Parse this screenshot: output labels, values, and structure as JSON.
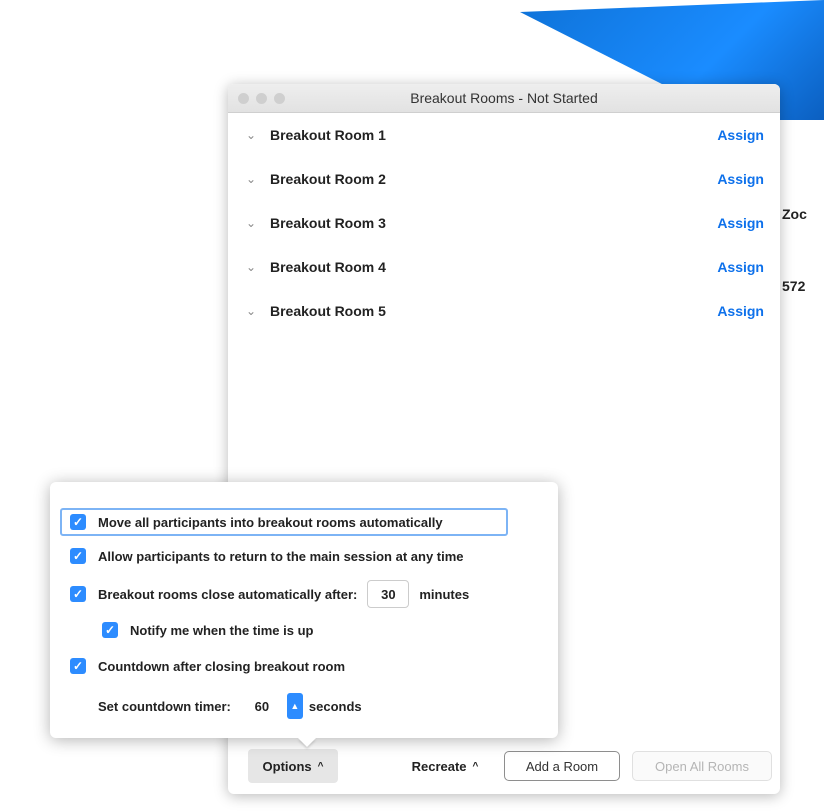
{
  "window": {
    "title": "Breakout Rooms - Not Started"
  },
  "rooms": [
    {
      "name": "Breakout Room 1",
      "action": "Assign"
    },
    {
      "name": "Breakout Room 2",
      "action": "Assign"
    },
    {
      "name": "Breakout Room 3",
      "action": "Assign"
    },
    {
      "name": "Breakout Room 4",
      "action": "Assign"
    },
    {
      "name": "Breakout Room 5",
      "action": "Assign"
    }
  ],
  "options": {
    "move_all": {
      "label": "Move all participants into breakout rooms automatically",
      "checked": true
    },
    "allow_return": {
      "label": "Allow participants to return to the main session at any time",
      "checked": true
    },
    "auto_close": {
      "label": "Breakout rooms close automatically after:",
      "value": "30",
      "unit": "minutes",
      "checked": true
    },
    "notify": {
      "label": "Notify me when the time is up",
      "checked": true
    },
    "countdown": {
      "label": "Countdown after closing breakout room",
      "checked": true
    },
    "timer": {
      "label": "Set countdown timer:",
      "value": "60",
      "unit": "seconds"
    }
  },
  "footer": {
    "options_label": "Options",
    "recreate_label": "Recreate",
    "add_room_label": "Add a Room",
    "open_all_label": "Open All Rooms"
  },
  "background": {
    "frag_1": "Zoc",
    "frag_2": "572"
  },
  "colors": {
    "accent": "#2d8cff",
    "link": "#0e71eb"
  }
}
